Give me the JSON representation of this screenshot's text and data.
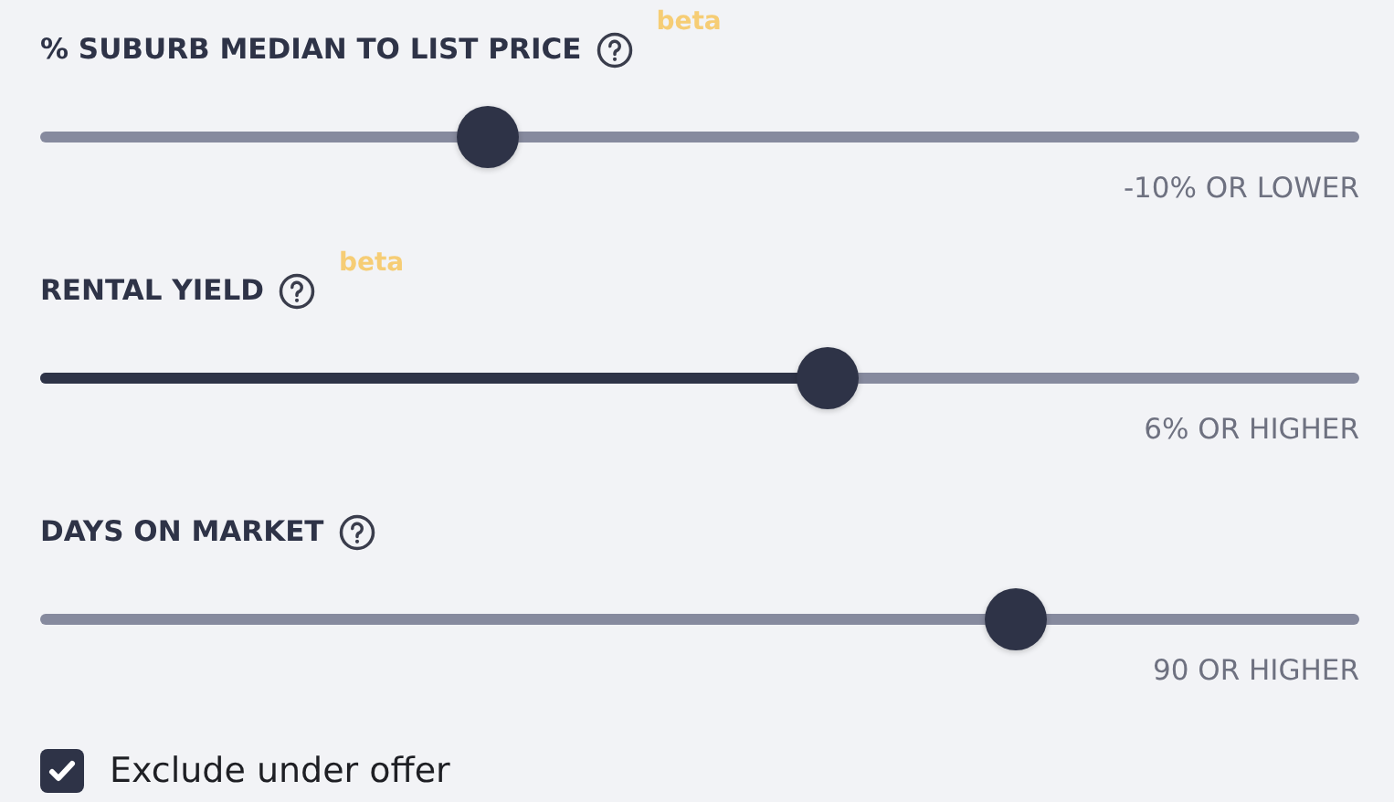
{
  "filters": [
    {
      "label": "% SUBURB MEDIAN TO LIST PRICE",
      "badge": "beta",
      "level": 0.34,
      "filled": false,
      "reading": "-10% OR LOWER"
    },
    {
      "label": "RENTAL YIELD",
      "badge": "beta",
      "level": 0.597,
      "filled": true,
      "reading": "6% OR HIGHER"
    },
    {
      "label": "DAYS ON MARKET",
      "level": 0.74,
      "filled": false,
      "reading": "90 OR HIGHER"
    }
  ],
  "checkbox": {
    "label": "Exclude under offer",
    "checked": true
  }
}
